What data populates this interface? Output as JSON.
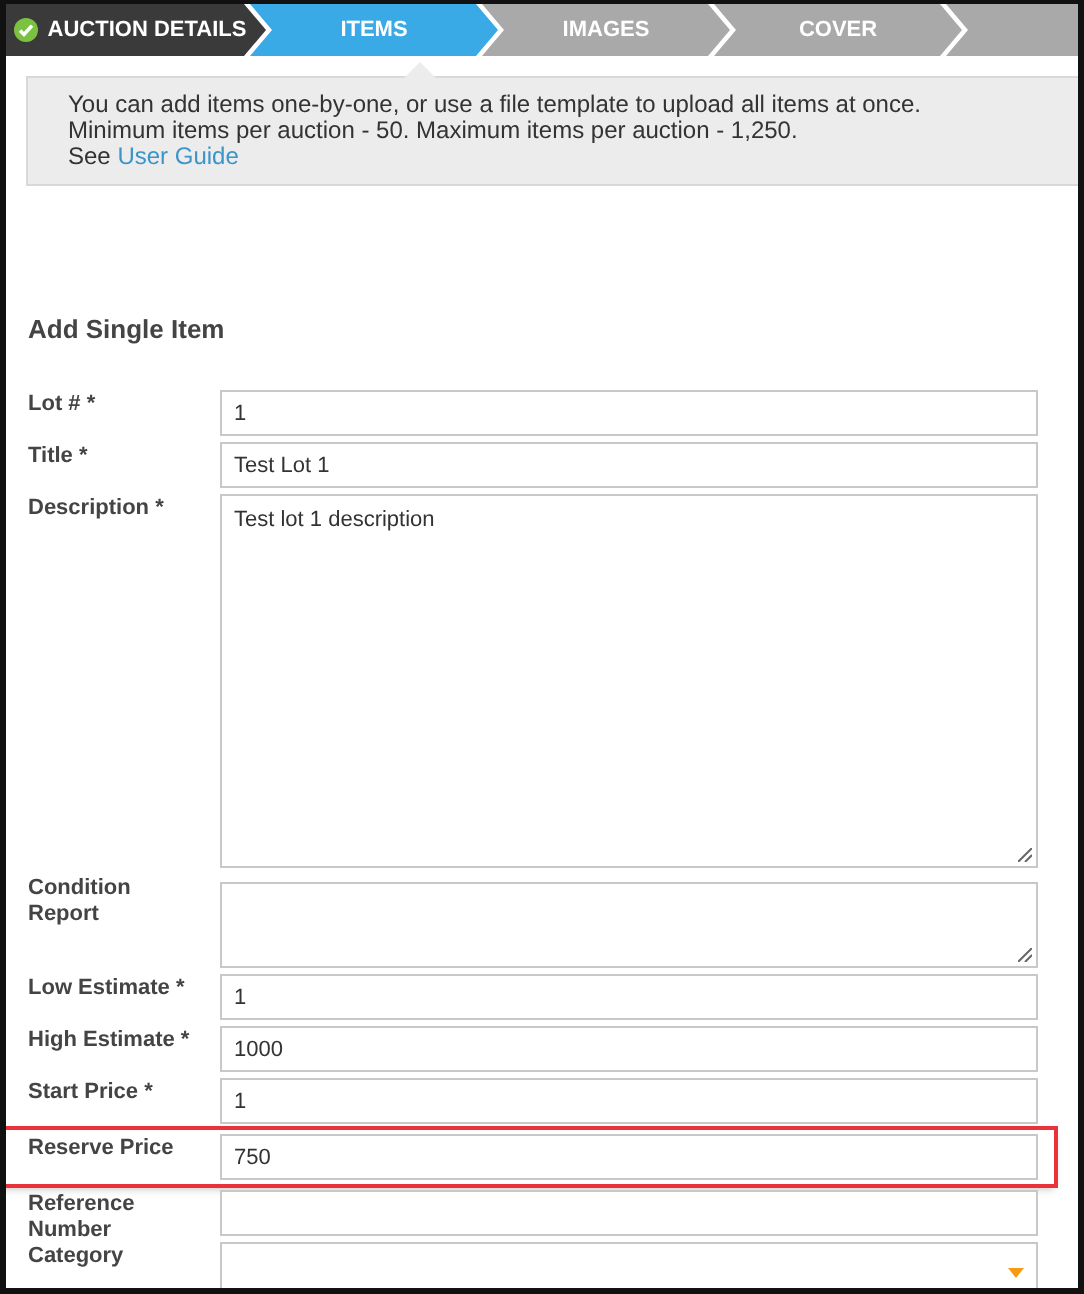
{
  "steps": [
    {
      "label": "AUCTION DETAILS",
      "completed": true,
      "selected": false
    },
    {
      "label": "ITEMS",
      "completed": false,
      "selected": true
    },
    {
      "label": "IMAGES",
      "completed": false,
      "selected": false
    },
    {
      "label": "COVER",
      "completed": false,
      "selected": false
    },
    {
      "completed": false,
      "selected": false
    }
  ],
  "info": {
    "lines": [
      "You can add items one-by-one, or use a file template to upload all items at once.",
      "Minimum items per auction - 50. Maximum items per auction - 1,250."
    ],
    "see": "See",
    "link": "User Guide"
  },
  "section_title": "Add Single Item",
  "fields": [
    {
      "label": "Lot # *",
      "kind": "input",
      "value": "1",
      "highlighted": false
    },
    {
      "label": "Title *",
      "kind": "input",
      "value": "Test Lot 1",
      "highlighted": false
    },
    {
      "label": "Description *",
      "kind": "textarea",
      "value": "Test lot 1 description",
      "highlighted": false
    },
    {
      "label": "Condition Report",
      "kind": "textarea-small",
      "highlighted": false
    },
    {
      "label": "Low Estimate *",
      "kind": "input",
      "value": "1",
      "highlighted": false
    },
    {
      "label": "High Estimate *",
      "kind": "input",
      "value": "1000",
      "highlighted": false
    },
    {
      "label": "Start Price *",
      "kind": "input",
      "value": "1",
      "highlighted": false
    },
    {
      "label": "Reserve Price",
      "kind": "input",
      "value": "750",
      "highlighted": true
    },
    {
      "label": "Reference Number",
      "kind": "input",
      "highlighted": false
    },
    {
      "label": "Category",
      "kind": "select",
      "highlighted": false
    }
  ]
}
